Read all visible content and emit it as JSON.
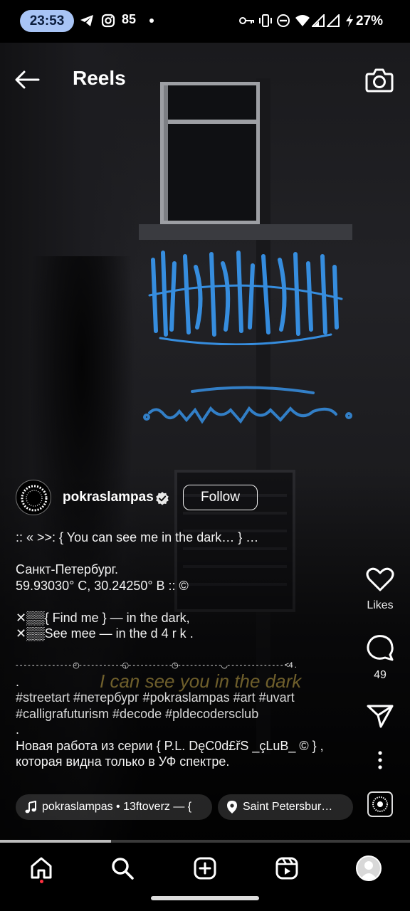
{
  "status_bar": {
    "time": "23:53",
    "notification_count": "85",
    "battery": "27%",
    "icons": [
      "telegram-icon",
      "instagram-icon",
      "key-icon",
      "vibrate-icon",
      "dnd-icon",
      "wifi-icon",
      "signal-icon",
      "signal-icon",
      "charging-icon"
    ]
  },
  "header": {
    "title": "Reels"
  },
  "post": {
    "username": "pokraslampas",
    "follow_label": "Follow",
    "caption_lines": [
      ":: « >>: { You can see me in the dark… } …",
      "",
      "Санкт-Петербург.",
      "59.93030° С, 30.24250° В :: ©",
      "",
      "✕▒▒{ Find me } — in the dark,",
      "✕▒▒See mee — in the d 4 r k .",
      "",
      "- - - - - - - - - - - - - - ◴- - - - - - - - - - -◵- - - - - - - - - - -◷- - - - - - - - - - -◡- - - - - - - - - - - - - - <4 .",
      ".",
      "#streetart #петербург #pokraslampas #art #uvart",
      "#calligrafuturism #decode #pldecodersclub",
      ".",
      "Новая работа из серии { P.L. DęC0d£řS _çLuB_ © } ,",
      "которая видна только в УФ спектре."
    ],
    "overlay_lyric": "I can see you in the dark",
    "audio_label": "pokraslampas • 13ftoverz — {",
    "location_label": "Saint Petersbur…",
    "progress": 0.27
  },
  "actions": {
    "likes_label": "Likes",
    "comments_count": "49"
  },
  "colors": {
    "time_pill": "#a8c4f5",
    "graffiti_blue": "#3aa0ff",
    "lyric_gold": "#c4a848",
    "notification_red": "#ff3040"
  },
  "nav": {
    "items": [
      "home-icon",
      "search-icon",
      "create-icon",
      "reels-icon",
      "profile-avatar"
    ]
  }
}
